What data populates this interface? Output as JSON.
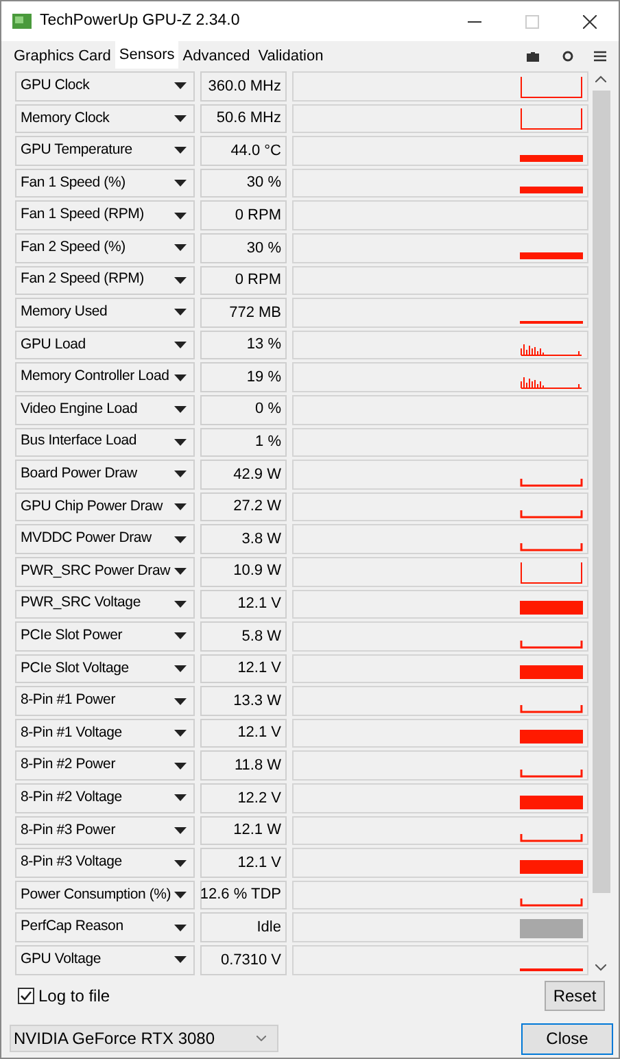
{
  "window": {
    "title": "TechPowerUp GPU-Z 2.34.0"
  },
  "tabs": [
    {
      "label": "Graphics Card",
      "selected": false
    },
    {
      "label": "Sensors",
      "selected": true
    },
    {
      "label": "Advanced",
      "selected": false
    },
    {
      "label": "Validation",
      "selected": false
    }
  ],
  "sensors": [
    {
      "name": "GPU Clock",
      "value": "360.0 MHz",
      "kind": "spike"
    },
    {
      "name": "Memory Clock",
      "value": "50.6 MHz",
      "kind": "spike"
    },
    {
      "name": "GPU Temperature",
      "value": "44.0 °C",
      "kind": "bar"
    },
    {
      "name": "Fan 1 Speed (%)",
      "value": "30 %",
      "kind": "bar"
    },
    {
      "name": "Fan 1 Speed (RPM)",
      "value": "0 RPM",
      "kind": "empty"
    },
    {
      "name": "Fan 2 Speed (%)",
      "value": "30 %",
      "kind": "bar"
    },
    {
      "name": "Fan 2 Speed (RPM)",
      "value": "0 RPM",
      "kind": "empty"
    },
    {
      "name": "Memory Used",
      "value": "772 MB",
      "kind": "line"
    },
    {
      "name": "GPU Load",
      "value": "13 %",
      "kind": "noise"
    },
    {
      "name": "Memory Controller Load",
      "value": "19 %",
      "kind": "noise"
    },
    {
      "name": "Video Engine Load",
      "value": "0 %",
      "kind": "empty"
    },
    {
      "name": "Bus Interface Load",
      "value": "1 %",
      "kind": "empty"
    },
    {
      "name": "Board Power Draw",
      "value": "42.9 W",
      "kind": "low"
    },
    {
      "name": "GPU Chip Power Draw",
      "value": "27.2 W",
      "kind": "low"
    },
    {
      "name": "MVDDC Power Draw",
      "value": "3.8 W",
      "kind": "low"
    },
    {
      "name": "PWR_SRC Power Draw",
      "value": "10.9 W",
      "kind": "spike"
    },
    {
      "name": "PWR_SRC Voltage",
      "value": "12.1 V",
      "kind": "block"
    },
    {
      "name": "PCIe Slot Power",
      "value": "5.8 W",
      "kind": "low"
    },
    {
      "name": "PCIe Slot Voltage",
      "value": "12.1 V",
      "kind": "block"
    },
    {
      "name": "8-Pin #1 Power",
      "value": "13.3 W",
      "kind": "low"
    },
    {
      "name": "8-Pin #1 Voltage",
      "value": "12.1 V",
      "kind": "block"
    },
    {
      "name": "8-Pin #2 Power",
      "value": "11.8 W",
      "kind": "low"
    },
    {
      "name": "8-Pin #2 Voltage",
      "value": "12.2 V",
      "kind": "block"
    },
    {
      "name": "8-Pin #3 Power",
      "value": "12.1 W",
      "kind": "low"
    },
    {
      "name": "8-Pin #3 Voltage",
      "value": "12.1 V",
      "kind": "block"
    },
    {
      "name": "Power Consumption (%)",
      "value": "12.6 % TDP",
      "kind": "low"
    },
    {
      "name": "PerfCap Reason",
      "value": "Idle",
      "kind": "gray"
    },
    {
      "name": "GPU Voltage",
      "value": "0.7310 V",
      "kind": "line"
    }
  ],
  "log_to_file": {
    "label": "Log to file",
    "checked": true
  },
  "reset_button": "Reset",
  "gpu_select": {
    "value": "NVIDIA GeForce RTX 3080"
  },
  "close_button": "Close"
}
